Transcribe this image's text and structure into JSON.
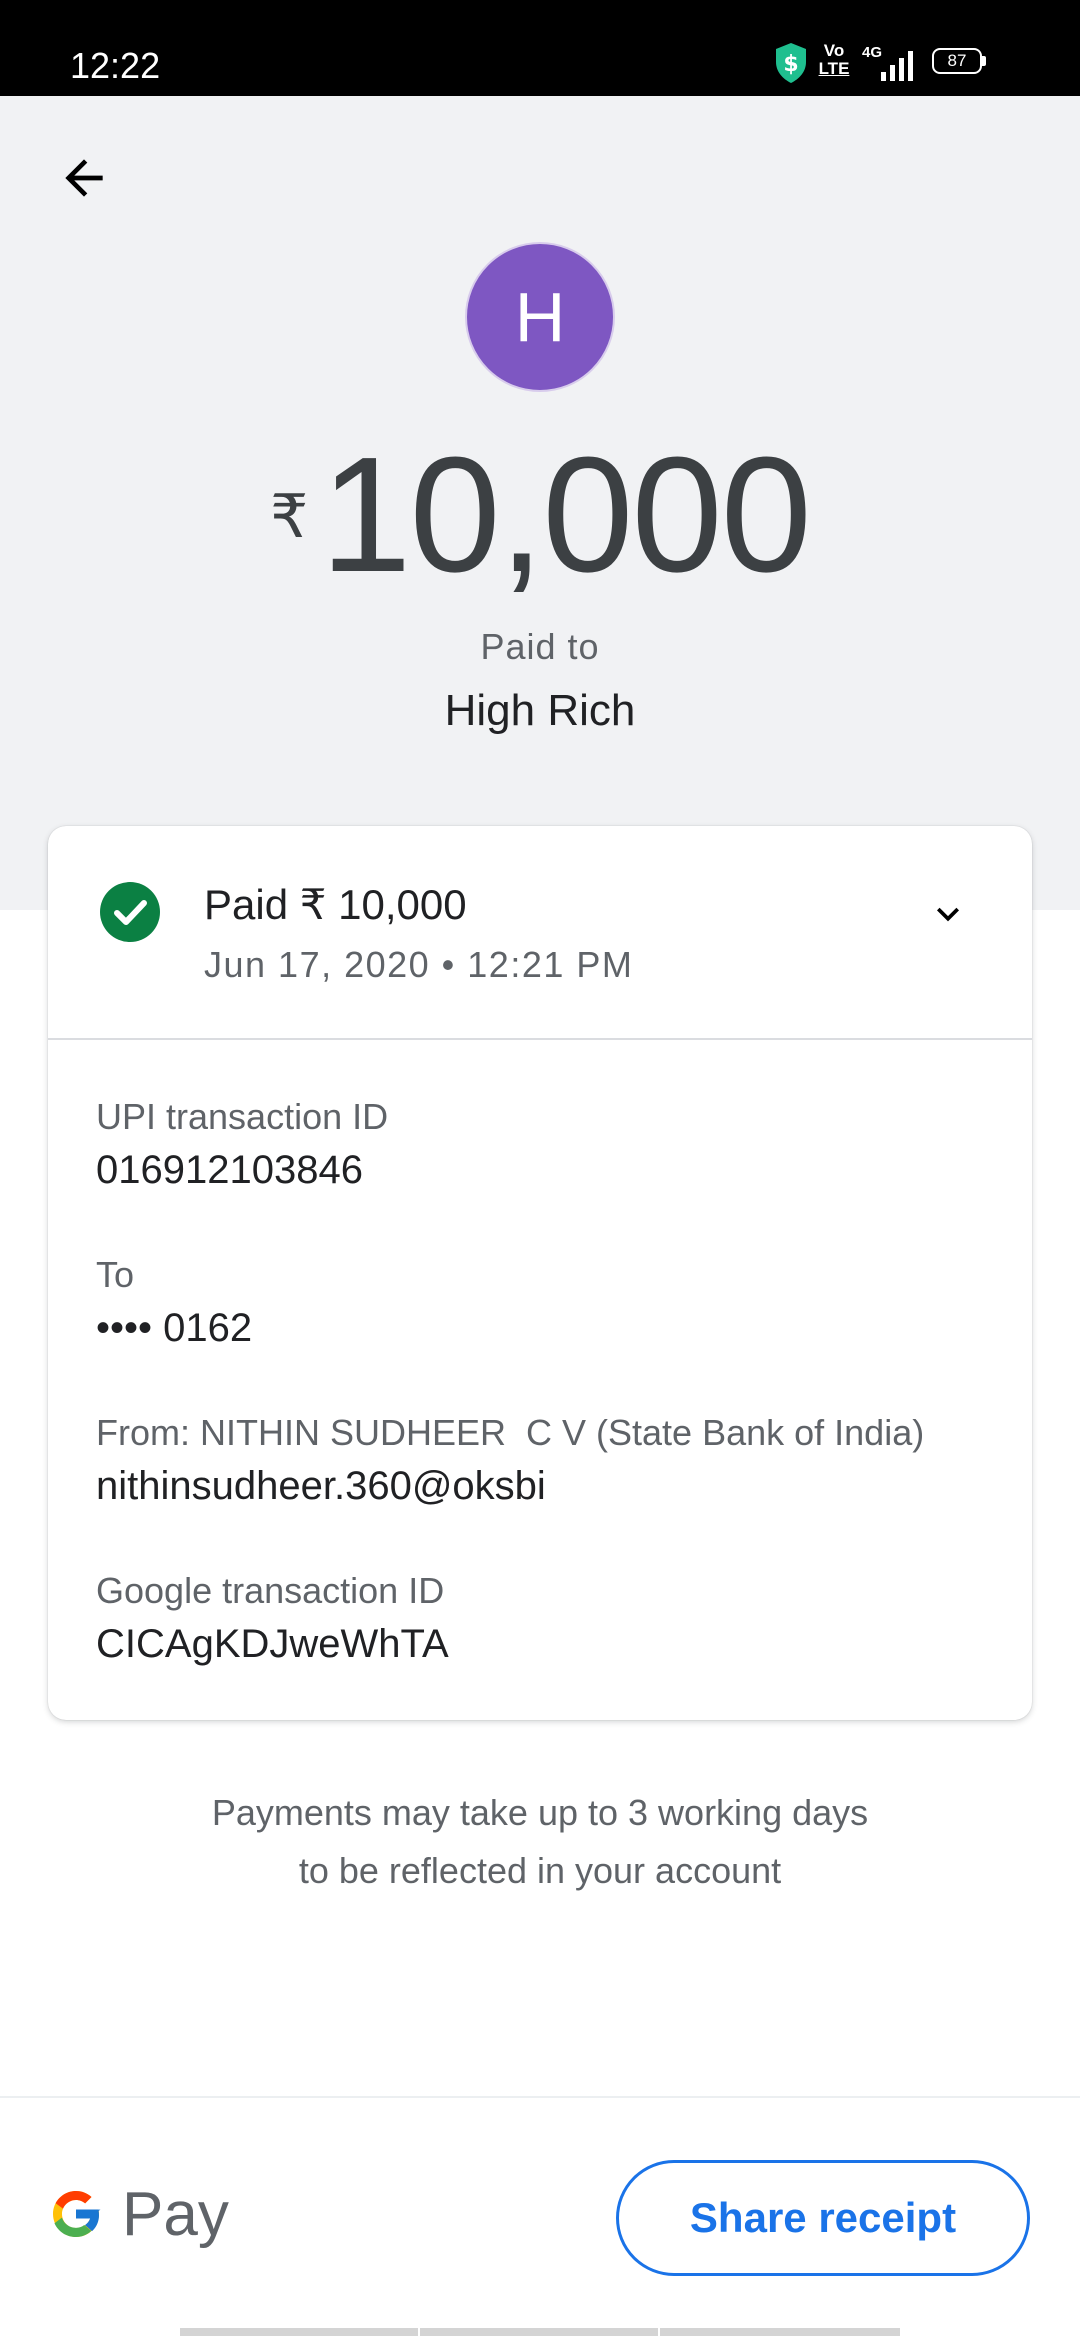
{
  "status_bar": {
    "time": "12:22",
    "volte_top": "Vo",
    "volte_bottom": "LTE",
    "network": "4G",
    "battery": "87",
    "icons": [
      "shield-dollar-icon",
      "volte-icon",
      "signal-icon",
      "battery-icon"
    ]
  },
  "header": {
    "back_icon": "arrow-left-icon",
    "avatar_initial": "H",
    "avatar_color": "#7e57c2",
    "currency_symbol": "₹",
    "amount": "10,000",
    "paid_to_label": "Paid to",
    "payee_name": "High Rich"
  },
  "summary": {
    "status_icon": "check-circle-icon",
    "status_color": "#0b8043",
    "paid_line": "Paid ₹ 10,000",
    "datetime": "Jun 17, 2020 • 12:21 PM",
    "expand_icon": "chevron-down-icon"
  },
  "details": [
    {
      "label": "UPI transaction ID",
      "value": "016912103846"
    },
    {
      "label": "To",
      "value": "•••• 0162"
    },
    {
      "label": "From: NITHIN SUDHEER  C V (State Bank of India)",
      "value": "nithinsudheer.360@oksbi"
    },
    {
      "label": "Google transaction ID",
      "value": "CICAgKDJweWhTA"
    }
  ],
  "notice": {
    "line1": "Payments may take up to 3 working days",
    "line2": "to be reflected in your account"
  },
  "footer": {
    "logo_text": "Pay",
    "share_label": "Share receipt",
    "accent_color": "#1a73e8"
  }
}
